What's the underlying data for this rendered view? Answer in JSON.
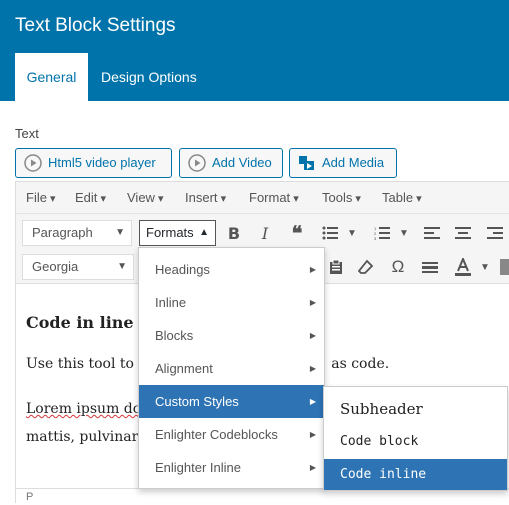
{
  "window": {
    "title": "Text Block Settings"
  },
  "tabs": [
    {
      "label": "General",
      "active": true
    },
    {
      "label": "Design Options",
      "active": false
    }
  ],
  "field_label": "Text",
  "media_buttons": [
    {
      "label": "Html5 video player",
      "icon": "play-circle-icon"
    },
    {
      "label": "Add Video",
      "icon": "play-circle-icon"
    },
    {
      "label": "Add Media",
      "icon": "media-icon"
    }
  ],
  "menubar": [
    "File",
    "Edit",
    "View",
    "Insert",
    "Format",
    "Tools",
    "Table"
  ],
  "toolbar": {
    "block_format": "Paragraph",
    "formats_label": "Formats",
    "font_family": "Georgia"
  },
  "content": {
    "heading": "Code in line",
    "paragraph1_start": "Use this tool to c",
    "paragraph1_end": "as code.",
    "paragraph2_line1_start": "Lorem ipsum do",
    "paragraph2_line2_start": "mattis, pulvinar"
  },
  "statusbar": {
    "path": "P"
  },
  "formats_menu": [
    {
      "label": "Headings",
      "has_submenu": true
    },
    {
      "label": "Inline",
      "has_submenu": true
    },
    {
      "label": "Blocks",
      "has_submenu": true
    },
    {
      "label": "Alignment",
      "has_submenu": true
    },
    {
      "label": "Custom Styles",
      "has_submenu": true,
      "active": true
    },
    {
      "label": "Enlighter Codeblocks",
      "has_submenu": true
    },
    {
      "label": "Enlighter Inline",
      "has_submenu": true
    }
  ],
  "custom_styles_submenu": [
    {
      "label": "Subheader"
    },
    {
      "label": "Code block"
    },
    {
      "label": "Code inline",
      "active": true
    }
  ],
  "colors": {
    "accent": "#0073aa",
    "highlight": "#2e74b5"
  }
}
